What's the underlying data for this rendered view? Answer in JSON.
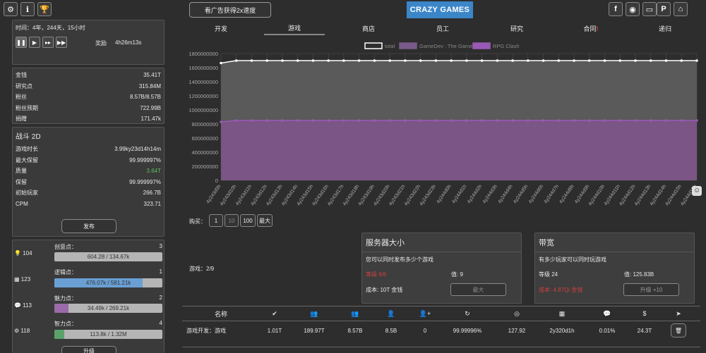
{
  "top_buttons": {
    "ad_speed": "看广告获得2x速度"
  },
  "logo": {
    "text": "CRAZY GAMES"
  },
  "time": {
    "label": "时间：4年，244天，15小时",
    "reward_label": "奖励",
    "reward_value": "4h26m13s"
  },
  "resources": [
    {
      "label": "金钱",
      "value": "35.41T"
    },
    {
      "label": "研究点",
      "value": "315.84M"
    },
    {
      "label": "粉丝",
      "value": "8.57B/8.57B"
    },
    {
      "label": "粉丝预期",
      "value": "722.99B"
    },
    {
      "label": "捐赠",
      "value": "171.47k"
    }
  ],
  "game": {
    "title": "战斗 2D",
    "publish_label": "发布",
    "stats": [
      {
        "label": "游戏时长",
        "value": "3.99ky23d14h14m"
      },
      {
        "label": "最大保留",
        "value": "99.999997%"
      },
      {
        "label": "质量",
        "value": "3.64T",
        "highlight": true
      },
      {
        "label": "保留",
        "value": "99.999997%"
      },
      {
        "label": "初始玩家",
        "value": "266.7B"
      },
      {
        "label": "CPM",
        "value": "323.71"
      }
    ]
  },
  "staff": [
    {
      "count": "104",
      "label": "创意点：",
      "level": "3",
      "text": "604.28 / 134.67k",
      "fraction": 0.0,
      "color": "#b5b5b5"
    },
    {
      "count": "123",
      "label": "逻辑点：",
      "level": "1",
      "text": "476.07k / 581.21k",
      "fraction": 0.82,
      "color": "#6a9fd4"
    },
    {
      "count": "113",
      "label": "魅力点：",
      "level": "2",
      "text": "34.49k / 269.21k",
      "fraction": 0.13,
      "color": "#9b6aa8"
    },
    {
      "count": "118",
      "label": "智力点：",
      "level": "4",
      "text": "113.8k / 1.32M",
      "fraction": 0.09,
      "color": "#5aa26a"
    }
  ],
  "upgrade_label": "升级",
  "tabs": [
    "开发",
    "游戏",
    "商店",
    "员工",
    "研究",
    "合同",
    "递归"
  ],
  "tabs_alert": "!",
  "chart_data": {
    "type": "area",
    "series": [
      {
        "name": "total",
        "color": "#ffffff",
        "values": [
          1665000000,
          1700000000,
          1700000000,
          1700000000,
          1700000000,
          1700000000,
          1700000000,
          1700000000,
          1700000000,
          1700000000,
          1700000000,
          1700000000,
          1700000000,
          1700000000,
          1700000000,
          1700000000,
          1700000000,
          1700000000,
          1700000000,
          1700000000,
          1700000000,
          1700000000,
          1700000000,
          1700000000,
          1700000000,
          1700000000,
          1700000000,
          1700000000,
          1700000000,
          1700000000,
          1700000000,
          1700000000
        ]
      },
      {
        "name": "GameDev : The Game",
        "color": "#7a5a8a",
        "values": [
          0,
          0,
          0,
          0,
          0,
          0,
          0,
          0,
          0,
          0,
          0,
          0,
          0,
          0,
          0,
          0,
          0,
          0,
          0,
          0,
          0,
          0,
          0,
          0,
          0,
          0,
          0,
          0,
          0,
          0,
          0,
          0
        ]
      },
      {
        "name": "RPG Clash",
        "color": "#9b59b6",
        "values": [
          830000000,
          850000000,
          850000000,
          850000000,
          850000000,
          850000000,
          850000000,
          850000000,
          850000000,
          850000000,
          850000000,
          850000000,
          850000000,
          850000000,
          850000000,
          850000000,
          850000000,
          850000000,
          850000000,
          850000000,
          850000000,
          850000000,
          850000000,
          850000000,
          850000000,
          850000000,
          850000000,
          850000000,
          850000000,
          850000000,
          850000000,
          850000000
        ]
      }
    ],
    "x": [
      "4y243d9h",
      "4y243d10h",
      "4y243d11h",
      "4y243d12h",
      "4y243d13h",
      "4y243d14h",
      "4y243d15h",
      "4y243d16h",
      "4y243d17h",
      "4y243d18h",
      "4y243d19h",
      "4y243d20h",
      "4y243d21h",
      "4y243d22h",
      "4y243d23h",
      "4y244d0h",
      "4y244d1h",
      "4y244d2h",
      "4y244d3h",
      "4y244d4h",
      "4y244d5h",
      "4y244d6h",
      "4y244d7h",
      "4y244d8h",
      "4y244d9h",
      "4y244d10h",
      "4y244d11h",
      "4y244d12h",
      "4y244d13h",
      "4y244d14h",
      "4y244d15h",
      "4y244d15h"
    ],
    "y_ticks": [
      "0",
      "200000000",
      "400000000",
      "600000000",
      "800000000",
      "1000000000",
      "1200000000",
      "1400000000",
      "1600000000",
      "1800000000"
    ],
    "ylim": [
      0,
      1800000000
    ],
    "legend_position": "top"
  },
  "buy": {
    "label": "购买：",
    "options": [
      "1",
      "10",
      "100",
      "最大"
    ]
  },
  "games_count": {
    "label": "游戏：",
    "value": "2/9"
  },
  "server": {
    "title": "服务器大小",
    "desc": "您可以同时发布多少个游戏",
    "level": "等级 6/6",
    "value": "值: 9",
    "cost": "成本: 10T 金钱",
    "button": "最大"
  },
  "bandwidth": {
    "title": "带宽",
    "desc": "有多少玩家可以同时玩游戏",
    "level": "等级 24",
    "value": "值: 125.83B",
    "cost": "成本: 4.87Qi 金钱",
    "button": "升级 +10"
  },
  "table": {
    "name_header": "名称",
    "row": {
      "name": "游戏开发：游戏",
      "c1": "1.01T",
      "c2": "189.97T",
      "c3": "8.57B",
      "c4": "8.5B",
      "c5": "0",
      "c6": "99.99996%",
      "c7": "127.92",
      "c8": "2y320d1h",
      "c9": "0.01%",
      "c10": "24.3T"
    }
  }
}
